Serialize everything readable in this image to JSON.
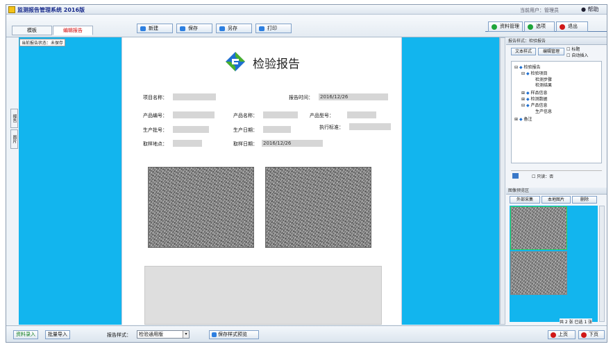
{
  "window": {
    "title": "监测报告管理系统 2016版",
    "status_text": "当前用户：管理员",
    "help_label": "帮助"
  },
  "tabs": [
    {
      "label": "模板"
    },
    {
      "label": "编辑报告"
    }
  ],
  "toolbar_buttons": [
    {
      "label": "新建"
    },
    {
      "label": "保存"
    },
    {
      "label": "另存"
    },
    {
      "label": "打印"
    }
  ],
  "right_buttons": [
    {
      "label": "资料管理",
      "color": "#1fa53a"
    },
    {
      "label": "选项",
      "color": "#1fa53a"
    },
    {
      "label": "退出",
      "color": "#d01818"
    }
  ],
  "side_tabs": [
    "报告",
    "图片"
  ],
  "note": "当前报告状态：未保存",
  "report": {
    "title": "检验报告",
    "fields": {
      "project_name": "项目名称：",
      "report_date_label": "报告时间：",
      "report_date": "2016/12/26",
      "product_no": "产品编号：",
      "product_name": "产品名称：",
      "product_model": "产品型号：",
      "batch_no": "生产批号：",
      "produce_date": "生产日期：",
      "standard": "执行标准：",
      "sample_place": "取样地点：",
      "sample_date_label": "取样日期：",
      "sample_date": "2016/12/26"
    }
  },
  "right_panel": {
    "header": "报告样式：检验报告",
    "btn_style": "文本样式",
    "btn_edit": "编辑管理",
    "check1": "标题",
    "check2": "自动插入",
    "tree": [
      "检验报告",
      "检验项目",
      "检测步骤",
      "检测结果",
      "样品信息",
      "检测数据",
      "产品信息",
      "生产信息",
      "备注"
    ],
    "tree_footer_label": "只读：否",
    "image_panel_header": "图像预览区",
    "img_btn_capture": "外部采集",
    "img_btn_local": "本地图片",
    "img_btn_delete": "删除",
    "image_footer": "共 2 张 已选 1 张"
  },
  "bottom": {
    "btn_data_entry": "资料录入",
    "btn_import": "批量导入",
    "format_label": "报告样式：",
    "format_value": "检验通用版",
    "apply_button": "保存样式预览",
    "prev_button": "上页",
    "next_button": "下页"
  }
}
